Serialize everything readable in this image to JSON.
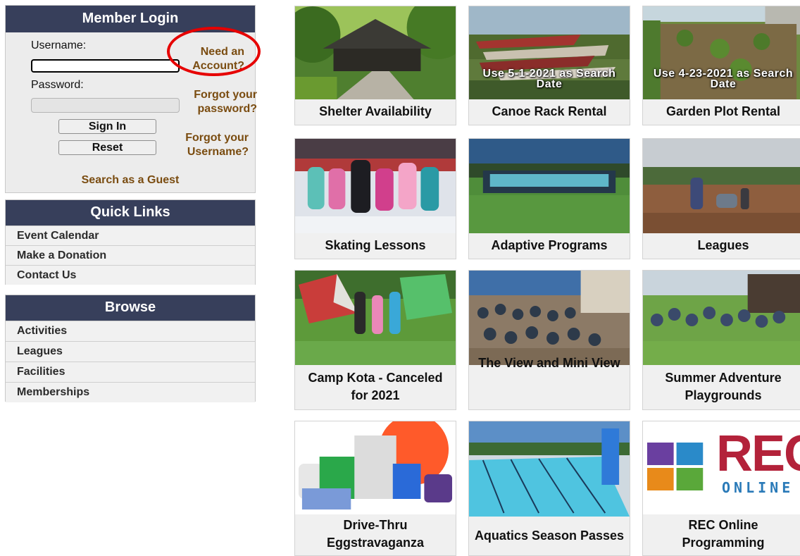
{
  "login": {
    "title": "Member Login",
    "username_label": "Username:",
    "password_label": "Password:",
    "sign_in_label": "Sign In",
    "reset_label": "Reset",
    "need_account": "Need an Account?",
    "forgot_password": "Forgot your password?",
    "forgot_username": "Forgot your Username?",
    "guest_search": "Search as a Guest",
    "username_value": "",
    "password_value": ""
  },
  "quick_links": {
    "title": "Quick Links",
    "items": [
      "Event Calendar",
      "Make a Donation",
      "Contact Us"
    ]
  },
  "browse": {
    "title": "Browse",
    "items": [
      "Activities",
      "Leagues",
      "Facilities",
      "Memberships"
    ]
  },
  "tiles": [
    {
      "label": "Shelter Availability",
      "overlay": ""
    },
    {
      "label": "Canoe Rack Rental",
      "overlay": "Use 5-1-2021 as Search Date"
    },
    {
      "label": "Garden Plot Rental",
      "overlay": "Use 4-23-2021 as Search Date"
    },
    {
      "label": "Skating Lessons",
      "overlay": ""
    },
    {
      "label": "Adaptive Programs",
      "overlay": ""
    },
    {
      "label": "Leagues",
      "overlay": ""
    },
    {
      "label": "Camp Kota - Canceled for 2021",
      "overlay": ""
    },
    {
      "label": "The View and Mini View",
      "overlay": ""
    },
    {
      "label": "Summer Adventure Playgrounds",
      "overlay": ""
    },
    {
      "label": "Drive-Thru Eggstravaganza",
      "overlay": ""
    },
    {
      "label": "Aquatics Season Passes",
      "overlay": ""
    },
    {
      "label": "REC Online Programming",
      "overlay": ""
    }
  ],
  "rec_logo": {
    "word": "REC",
    "sub": "ONLINE"
  },
  "colors": {
    "panel_header": "#373f5b",
    "link_brown": "#7a4c10",
    "highlight_red": "#e60000"
  }
}
